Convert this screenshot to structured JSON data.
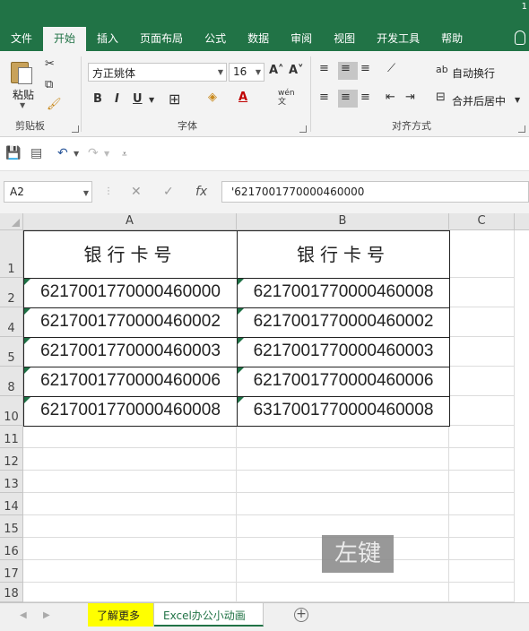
{
  "app": {
    "corner_mark": "1",
    "accent": "#217346"
  },
  "tabs": [
    "文件",
    "开始",
    "插入",
    "页面布局",
    "公式",
    "数据",
    "审阅",
    "视图",
    "开发工具",
    "帮助"
  ],
  "ribbon": {
    "clipboard": {
      "paste_label": "粘贴",
      "group_label": "剪贴板"
    },
    "font": {
      "font_name": "方正姚体",
      "font_size": "16",
      "bold": "B",
      "italic": "I",
      "underline": "U",
      "group_label": "字体",
      "wen_label": "wén\n文"
    },
    "alignment": {
      "wrap_label": "自动换行",
      "merge_label": "合并后居中",
      "group_label": "对齐方式"
    }
  },
  "formula_bar": {
    "name_box": "A2",
    "formula": "'6217001770000460000",
    "fx": "fx"
  },
  "grid": {
    "columns": [
      "A",
      "B",
      "C"
    ],
    "rows": [
      "1",
      "2",
      "4",
      "5",
      "8",
      "10",
      "11",
      "12",
      "13",
      "14",
      "15",
      "16",
      "17",
      "18"
    ],
    "table": {
      "headers": [
        "银行卡号",
        "银行卡号"
      ],
      "rows": [
        [
          "6217001770000460000",
          "6217001770000460008"
        ],
        [
          "6217001770000460002",
          "6217001770000460002"
        ],
        [
          "6217001770000460003",
          "6217001770000460003"
        ],
        [
          "6217001770000460006",
          "6217001770000460006"
        ],
        [
          "6217001770000460008",
          "6317001770000460008"
        ]
      ]
    }
  },
  "watermark": "左键",
  "sheets": {
    "promo": "了解更多",
    "active": "Excel办公小动画"
  }
}
